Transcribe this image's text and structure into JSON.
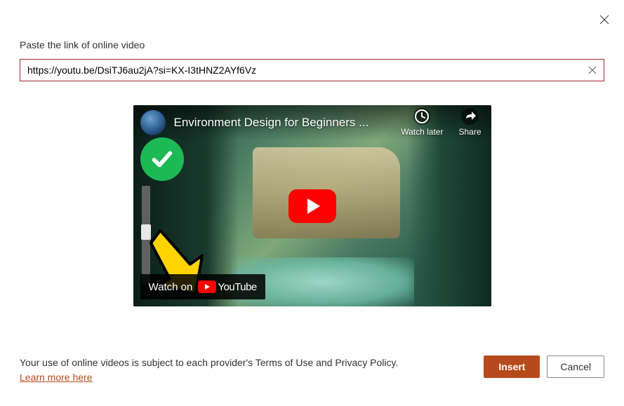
{
  "dialog": {
    "prompt": "Paste the link of online video",
    "url_value": "https://youtu.be/DsiTJ6au2jA?si=KX-I3tHNZ2AYf6Vz"
  },
  "video": {
    "title": "Environment Design for Beginners ...",
    "watch_later": "Watch later",
    "share": "Share",
    "watch_on": "Watch on",
    "platform": "YouTube"
  },
  "footer": {
    "disclaimer_text": "Your use of online videos is subject to each provider's Terms of Use and Privacy Policy.",
    "learn_more": "Learn more here"
  },
  "buttons": {
    "insert": "Insert",
    "cancel": "Cancel"
  },
  "icons": {
    "close": "close-icon",
    "clear": "clear-icon",
    "clock": "watch-later-icon",
    "share": "share-icon",
    "check": "checkmark-icon",
    "arrow": "yellow-arrow-icon",
    "play": "play-icon"
  }
}
